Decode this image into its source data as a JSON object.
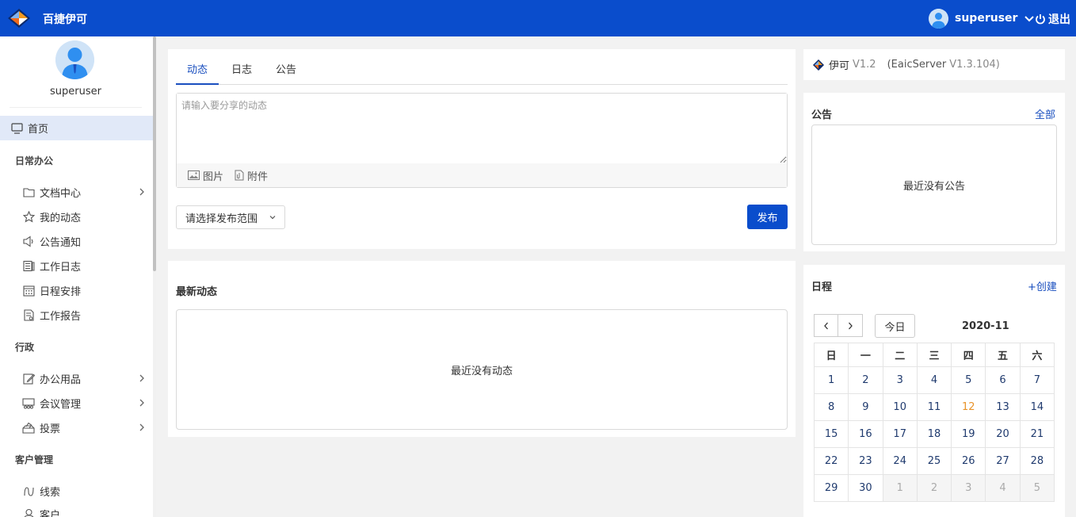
{
  "header": {
    "app_title": "百捷伊可",
    "username": "superuser",
    "logout_label": "退出",
    "bg_color": "#0a4dcc"
  },
  "sidebar": {
    "profile_name": "superuser",
    "home_label": "首页",
    "sections": [
      {
        "title": "日常办公",
        "items": [
          {
            "label": "文档中心",
            "icon": "folder-icon",
            "expandable": true
          },
          {
            "label": "我的动态",
            "icon": "star-icon",
            "expandable": false
          },
          {
            "label": "公告通知",
            "icon": "speaker-icon",
            "expandable": false
          },
          {
            "label": "工作日志",
            "icon": "log-icon",
            "expandable": false
          },
          {
            "label": "日程安排",
            "icon": "calendar-icon",
            "expandable": false
          },
          {
            "label": "工作报告",
            "icon": "report-icon",
            "expandable": false
          }
        ]
      },
      {
        "title": "行政",
        "items": [
          {
            "label": "办公用品",
            "icon": "edit-icon",
            "expandable": true
          },
          {
            "label": "会议管理",
            "icon": "meeting-icon",
            "expandable": true
          },
          {
            "label": "投票",
            "icon": "vote-icon",
            "expandable": true
          }
        ]
      },
      {
        "title": "客户管理",
        "items": [
          {
            "label": "线索",
            "icon": "clue-icon",
            "expandable": false
          },
          {
            "label": "客户",
            "icon": "customer-icon",
            "expandable": false
          }
        ]
      }
    ]
  },
  "post": {
    "tabs": [
      "动态",
      "日志",
      "公告"
    ],
    "active_tab": 0,
    "placeholder": "请输入要分享的动态",
    "image_label": "图片",
    "attachment_label": "附件",
    "scope_placeholder": "请选择发布范围",
    "publish_label": "发布"
  },
  "feed": {
    "title": "最新动态",
    "empty_text": "最近没有动态"
  },
  "version": {
    "name": "伊可",
    "version": "V1.2",
    "server": "(EaicServer",
    "server_version": "V1.3.104)"
  },
  "notices": {
    "title": "公告",
    "all_link": "全部",
    "empty_text": "最近没有公告"
  },
  "schedule": {
    "title": "日程",
    "create_link": "+创建",
    "today_label": "今日",
    "month": "2020-11",
    "weekdays": [
      "日",
      "一",
      "二",
      "三",
      "四",
      "五",
      "六"
    ],
    "today_day": 12,
    "today_color": "#e8932a",
    "weeks": [
      [
        "1",
        "2",
        "3",
        "4",
        "5",
        "6",
        "7"
      ],
      [
        "8",
        "9",
        "10",
        "11",
        "12",
        "13",
        "14"
      ],
      [
        "15",
        "16",
        "17",
        "18",
        "19",
        "20",
        "21"
      ],
      [
        "22",
        "23",
        "24",
        "25",
        "26",
        "27",
        "28"
      ],
      [
        "29",
        "30",
        "1",
        "2",
        "3",
        "4",
        "5"
      ]
    ],
    "trailing_other_month_count": 5
  }
}
